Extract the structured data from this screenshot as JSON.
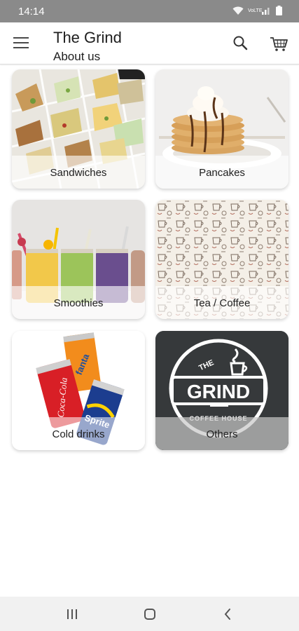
{
  "status_bar": {
    "time": "14:14",
    "wifi_icon": "wifi-icon",
    "signal_label": "VoLTE",
    "battery_icon": "battery-icon"
  },
  "app_bar": {
    "title": "The Grind",
    "subtitle": "About us",
    "menu_icon": "hamburger-menu-icon",
    "search_icon": "search-icon",
    "cart_icon": "cart-icon"
  },
  "categories": [
    {
      "label": "Sandwiches",
      "image": "sandwiches-image"
    },
    {
      "label": "Pancakes",
      "image": "pancakes-image"
    },
    {
      "label": "Smoothies",
      "image": "smoothies-image"
    },
    {
      "label": "Tea / Coffee",
      "image": "tea-coffee-image"
    },
    {
      "label": "Cold drinks",
      "image": "cold-drinks-image"
    },
    {
      "label": "Others",
      "image": "grind-logo-image"
    }
  ],
  "logo": {
    "top_text": "THE",
    "main_text": "GRIND",
    "bottom_text": "COFFEE HOUSE"
  },
  "nav_bar": {
    "recents_icon": "recent-apps-icon",
    "home_icon": "home-icon",
    "back_icon": "back-icon"
  },
  "colors": {
    "status_bar": "#8a8a8a",
    "logo_dark": "#36393b",
    "nav_bar": "#f1f1f1"
  }
}
